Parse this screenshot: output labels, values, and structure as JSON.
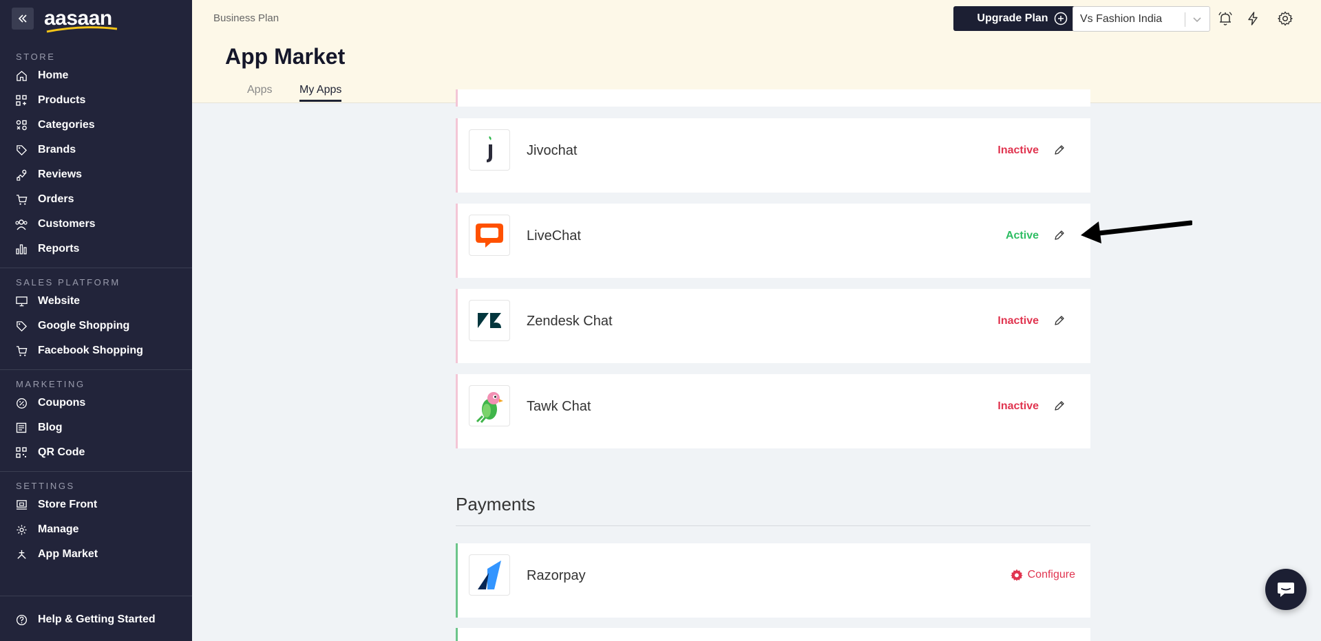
{
  "sidebar": {
    "logo_text": "aasaan",
    "sections": [
      {
        "title": "STORE",
        "items": [
          {
            "label": "Home",
            "icon": "home-icon"
          },
          {
            "label": "Products",
            "icon": "grid-icon"
          },
          {
            "label": "Categories",
            "icon": "categories-icon"
          },
          {
            "label": "Brands",
            "icon": "tag-icon"
          },
          {
            "label": "Reviews",
            "icon": "reviews-icon"
          },
          {
            "label": "Orders",
            "icon": "cart-icon"
          },
          {
            "label": "Customers",
            "icon": "users-icon"
          },
          {
            "label": "Reports",
            "icon": "bar-chart-icon"
          }
        ]
      },
      {
        "title": "SALES PLATFORM",
        "items": [
          {
            "label": "Website",
            "icon": "monitor-icon"
          },
          {
            "label": "Google Shopping",
            "icon": "tag-icon"
          },
          {
            "label": "Facebook Shopping",
            "icon": "cart-icon"
          }
        ]
      },
      {
        "title": "MARKETING",
        "items": [
          {
            "label": "Coupons",
            "icon": "coupon-icon"
          },
          {
            "label": "Blog",
            "icon": "blog-icon"
          },
          {
            "label": "QR Code",
            "icon": "qr-icon"
          }
        ]
      },
      {
        "title": "SETTINGS",
        "items": [
          {
            "label": "Store Front",
            "icon": "storefront-icon"
          },
          {
            "label": "Manage",
            "icon": "gear-icon"
          },
          {
            "label": "App Market",
            "icon": "app-market-icon"
          }
        ]
      }
    ],
    "help_label": "Help & Getting Started"
  },
  "header": {
    "plan": "Business Plan",
    "title": "App Market",
    "tabs": [
      {
        "label": "Apps"
      },
      {
        "label": "My Apps"
      }
    ],
    "upgrade_label": "Upgrade Plan",
    "store_name": "Vs Fashion India"
  },
  "apps": [
    {
      "name": "Jivochat",
      "status": "Inactive"
    },
    {
      "name": "LiveChat",
      "status": "Active"
    },
    {
      "name": "Zendesk Chat",
      "status": "Inactive"
    },
    {
      "name": "Tawk Chat",
      "status": "Inactive"
    }
  ],
  "payments": {
    "section_title": "Payments",
    "apps": [
      {
        "name": "Razorpay",
        "action": "Configure"
      }
    ]
  },
  "colors": {
    "sidebar_bg": "#22243a",
    "header_bg": "#fdf8e8",
    "inactive": "#e0344f",
    "active": "#2ebd63"
  }
}
